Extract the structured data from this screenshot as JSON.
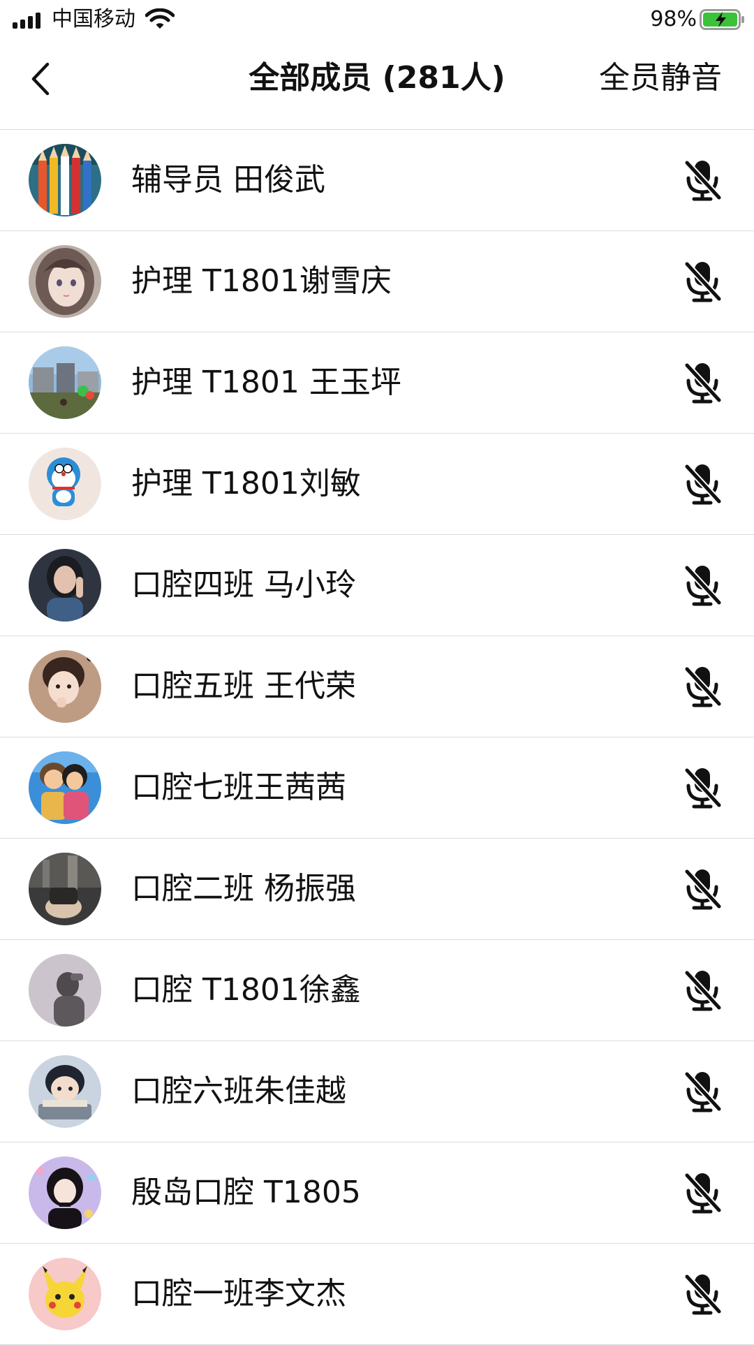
{
  "status_bar": {
    "carrier": "中国移动",
    "battery_percent": "98%",
    "battery_level": 0.98,
    "icons": [
      "signal-icon",
      "wifi-icon",
      "battery-charging-icon"
    ]
  },
  "nav": {
    "back_icon": "chevron-left-icon",
    "title": "全部成员 (281人)",
    "mute_all_label": "全员静音"
  },
  "members": [
    {
      "name": "辅导员 田俊武",
      "avatar": "pencils",
      "mic_icon": "mic-muted-icon"
    },
    {
      "name": "护理 T1801谢雪庆",
      "avatar": "anime-girl",
      "mic_icon": "mic-muted-icon"
    },
    {
      "name": "护理 T1801 王玉坪",
      "avatar": "street-scene",
      "mic_icon": "mic-muted-icon"
    },
    {
      "name": "护理 T1801刘敏",
      "avatar": "doraemon",
      "mic_icon": "mic-muted-icon"
    },
    {
      "name": "口腔四班 马小玲",
      "avatar": "portrait-dark",
      "mic_icon": "mic-muted-icon"
    },
    {
      "name": "口腔五班 王代荣",
      "avatar": "child-portrait",
      "mic_icon": "mic-muted-icon"
    },
    {
      "name": "口腔七班王茜茜",
      "avatar": "anime-couple",
      "mic_icon": "mic-muted-icon"
    },
    {
      "name": "口腔二班  杨振强",
      "avatar": "room-photo",
      "mic_icon": "mic-muted-icon"
    },
    {
      "name": "口腔 T1801徐鑫",
      "avatar": "silhouette",
      "mic_icon": "mic-muted-icon"
    },
    {
      "name": "口腔六班朱佳越",
      "avatar": "anime-boy",
      "mic_icon": "mic-muted-icon"
    },
    {
      "name": "殷岛口腔 T1805",
      "avatar": "anime-girl-dark-hair",
      "mic_icon": "mic-muted-icon"
    },
    {
      "name": "口腔一班李文杰",
      "avatar": "pikachu",
      "mic_icon": "mic-muted-icon"
    }
  ],
  "colors": {
    "text": "#111111",
    "divider": "#dcdcdc",
    "battery_fill": "#3cc13b"
  }
}
